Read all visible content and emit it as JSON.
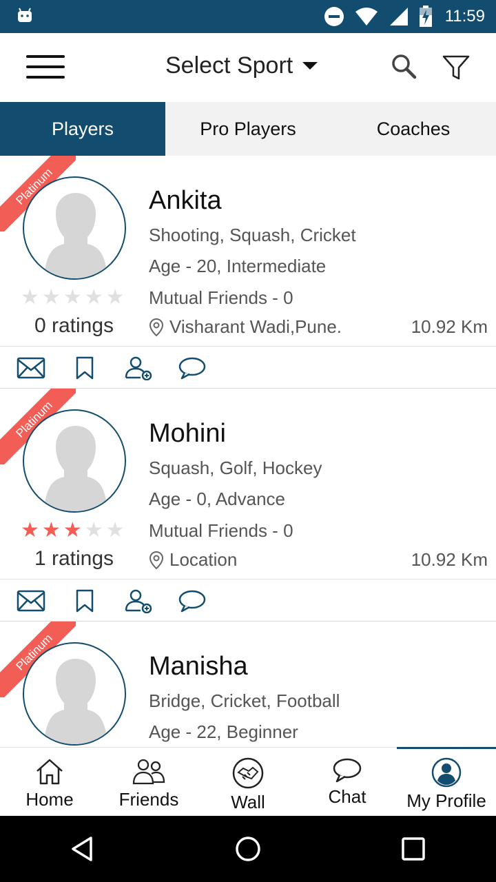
{
  "statusbar": {
    "time": "11:59"
  },
  "appbar": {
    "title": "Select Sport"
  },
  "tabs": [
    {
      "label": "Players",
      "active": true
    },
    {
      "label": "Pro Players",
      "active": false
    },
    {
      "label": "Coaches",
      "active": false
    }
  ],
  "cards": [
    {
      "badge": "Platinum",
      "name": "Ankita",
      "sports": "Shooting, Squash, Cricket",
      "age": "Age - 20, Intermediate",
      "mutual": "Mutual Friends - 0",
      "location": "Visharant Wadi,Pune.",
      "distance": "10.92 Km",
      "ratings_text": "0 ratings",
      "stars": 0
    },
    {
      "badge": "Platinum",
      "name": "Mohini",
      "sports": "Squash, Golf, Hockey",
      "age": "Age - 0, Advance",
      "mutual": "Mutual Friends - 0",
      "location": "Location",
      "distance": "10.92 Km",
      "ratings_text": "1 ratings",
      "stars": 3
    },
    {
      "badge": "Platinum",
      "name": "Manisha",
      "sports": "Bridge, Cricket, Football",
      "age": "Age - 22, Beginner"
    }
  ],
  "bottomnav": [
    {
      "label": "Home",
      "icon": "home-icon"
    },
    {
      "label": "Friends",
      "icon": "friends-icon"
    },
    {
      "label": "Wall",
      "icon": "handshake-icon"
    },
    {
      "label": "Chat",
      "icon": "chat-icon"
    },
    {
      "label": "My Profile",
      "icon": "profile-icon",
      "active": true
    }
  ],
  "colors": {
    "primary": "#124c6e",
    "accent": "#f25e55",
    "tab_bg": "#f2f2f2"
  }
}
